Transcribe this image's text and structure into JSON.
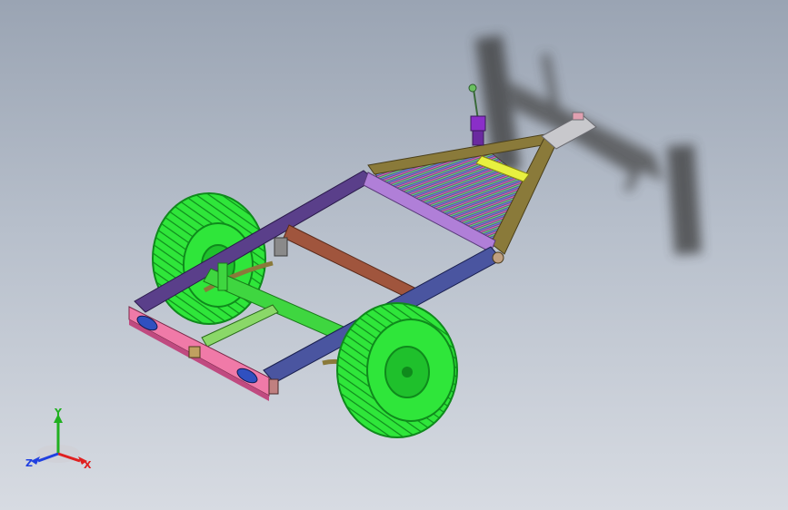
{
  "viewport": {
    "background_top": "#9aa4b3",
    "background_bottom": "#d7dbe2"
  },
  "model": {
    "colors": {
      "tire": "#2fe63a",
      "tire_dark": "#0f8a1c",
      "rear_beam": "#f07aa8",
      "side_frame": "#4a55a0",
      "front_frame": "#5a3f8a",
      "cross_member": "#a0553d",
      "axle_brace": "#3fd640",
      "tongue": "#8a7a3a",
      "lavender_beam": "#b07fd8",
      "yellow_bar": "#e8f040",
      "jack": "#8a2fc8"
    }
  },
  "triad": {
    "x_label": "X",
    "y_label": "Y",
    "z_label": "Z",
    "x_color": "#e02020",
    "y_color": "#20b020",
    "z_color": "#2040e0"
  }
}
